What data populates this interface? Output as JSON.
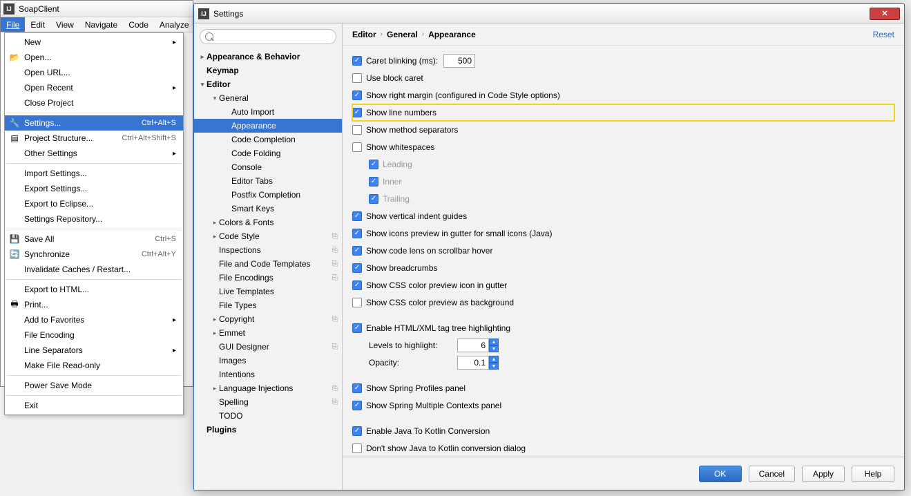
{
  "main_window": {
    "title": "SoapClient"
  },
  "menubar": [
    "File",
    "Edit",
    "View",
    "Navigate",
    "Code",
    "Analyze"
  ],
  "file_menu": {
    "items": [
      {
        "label": "New",
        "submenu": true
      },
      {
        "label": "Open...",
        "icon": "folder"
      },
      {
        "label": "Open URL..."
      },
      {
        "label": "Open Recent",
        "submenu": true
      },
      {
        "label": "Close Project"
      },
      {
        "sep": true
      },
      {
        "label": "Settings...",
        "shortcut": "Ctrl+Alt+S",
        "hl": true,
        "icon": "wrench"
      },
      {
        "label": "Project Structure...",
        "shortcut": "Ctrl+Alt+Shift+S",
        "icon": "structure"
      },
      {
        "label": "Other Settings",
        "submenu": true
      },
      {
        "sep": true
      },
      {
        "label": "Import Settings..."
      },
      {
        "label": "Export Settings..."
      },
      {
        "label": "Export to Eclipse..."
      },
      {
        "label": "Settings Repository..."
      },
      {
        "sep": true
      },
      {
        "label": "Save All",
        "shortcut": "Ctrl+S",
        "icon": "save"
      },
      {
        "label": "Synchronize",
        "shortcut": "Ctrl+Alt+Y",
        "icon": "sync"
      },
      {
        "label": "Invalidate Caches / Restart..."
      },
      {
        "sep": true
      },
      {
        "label": "Export to HTML..."
      },
      {
        "label": "Print...",
        "icon": "print"
      },
      {
        "label": "Add to Favorites",
        "submenu": true
      },
      {
        "label": "File Encoding"
      },
      {
        "label": "Line Separators",
        "submenu": true
      },
      {
        "label": "Make File Read-only"
      },
      {
        "sep": true
      },
      {
        "label": "Power Save Mode"
      },
      {
        "sep": true
      },
      {
        "label": "Exit"
      }
    ]
  },
  "settings": {
    "title": "Settings",
    "search_placeholder": "",
    "tree": [
      {
        "label": "Appearance & Behavior",
        "bold": true,
        "depth": 0,
        "arrow": "▸"
      },
      {
        "label": "Keymap",
        "bold": true,
        "depth": 0
      },
      {
        "label": "Editor",
        "bold": true,
        "depth": 0,
        "arrow": "▾"
      },
      {
        "label": "General",
        "depth": 1,
        "arrow": "▾"
      },
      {
        "label": "Auto Import",
        "depth": 2
      },
      {
        "label": "Appearance",
        "depth": 2,
        "sel": true
      },
      {
        "label": "Code Completion",
        "depth": 2
      },
      {
        "label": "Code Folding",
        "depth": 2
      },
      {
        "label": "Console",
        "depth": 2
      },
      {
        "label": "Editor Tabs",
        "depth": 2
      },
      {
        "label": "Postfix Completion",
        "depth": 2
      },
      {
        "label": "Smart Keys",
        "depth": 2
      },
      {
        "label": "Colors & Fonts",
        "depth": 1,
        "arrow": "▸"
      },
      {
        "label": "Code Style",
        "depth": 1,
        "arrow": "▸",
        "copy": true
      },
      {
        "label": "Inspections",
        "depth": 1,
        "copy": true
      },
      {
        "label": "File and Code Templates",
        "depth": 1,
        "copy": true
      },
      {
        "label": "File Encodings",
        "depth": 1,
        "copy": true
      },
      {
        "label": "Live Templates",
        "depth": 1
      },
      {
        "label": "File Types",
        "depth": 1
      },
      {
        "label": "Copyright",
        "depth": 1,
        "arrow": "▸",
        "copy": true
      },
      {
        "label": "Emmet",
        "depth": 1,
        "arrow": "▸"
      },
      {
        "label": "GUI Designer",
        "depth": 1,
        "copy": true
      },
      {
        "label": "Images",
        "depth": 1
      },
      {
        "label": "Intentions",
        "depth": 1
      },
      {
        "label": "Language Injections",
        "depth": 1,
        "arrow": "▸",
        "copy": true
      },
      {
        "label": "Spelling",
        "depth": 1,
        "copy": true
      },
      {
        "label": "TODO",
        "depth": 1
      },
      {
        "label": "Plugins",
        "bold": true,
        "depth": 0
      }
    ],
    "breadcrumb": [
      "Editor",
      "General",
      "Appearance"
    ],
    "reset": "Reset",
    "form": {
      "caret_blinking": "Caret blinking (ms):",
      "caret_blinking_value": "500",
      "use_block_caret": "Use block caret",
      "show_right_margin": "Show right margin (configured in Code Style options)",
      "show_line_numbers": "Show line numbers",
      "show_method_separators": "Show method separators",
      "show_whitespaces": "Show whitespaces",
      "ws_leading": "Leading",
      "ws_inner": "Inner",
      "ws_trailing": "Trailing",
      "show_vertical_indent": "Show vertical indent guides",
      "show_icons_preview": "Show icons preview in gutter for small icons (Java)",
      "show_code_lens": "Show code lens on scrollbar hover",
      "show_breadcrumbs": "Show breadcrumbs",
      "show_css_preview_gutter": "Show CSS color preview icon in gutter",
      "show_css_preview_bg": "Show CSS color preview as background",
      "enable_html_tag_tree": "Enable HTML/XML tag tree highlighting",
      "levels_to_highlight": "Levels to highlight:",
      "levels_value": "6",
      "opacity": "Opacity:",
      "opacity_value": "0.1",
      "show_spring_profiles": "Show Spring Profiles panel",
      "show_spring_multiple": "Show Spring Multiple Contexts panel",
      "enable_java_kotlin": "Enable Java To Kotlin Conversion",
      "dont_show_kotlin_dialog": "Don't show Java to Kotlin conversion dialog"
    },
    "buttons": {
      "ok": "OK",
      "cancel": "Cancel",
      "apply": "Apply",
      "help": "Help"
    }
  }
}
